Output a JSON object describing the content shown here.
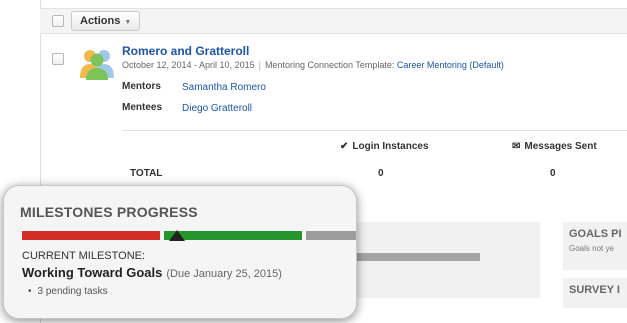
{
  "toolbar": {
    "actions_label": "Actions"
  },
  "connection": {
    "title": "Romero and Gratteroll",
    "dates": "October 12, 2014 - April 10, 2015",
    "template_prefix": "Mentoring Connection Template:",
    "template_link": "Career Mentoring (Default)",
    "mentors_label": "Mentors",
    "mentor_name": "Samantha Romero",
    "mentees_label": "Mentees",
    "mentee_name": "Diego Gratteroll"
  },
  "stats": {
    "login_header": "Login Instances",
    "messages_header": "Messages Sent",
    "total_label": "TOTAL",
    "login_total": "0",
    "messages_total": "0"
  },
  "side_panels": {
    "goals_heading": "GOALS PI",
    "goals_subtext": "Goals not ye",
    "survey_heading": "SURVEY I"
  },
  "milestones": {
    "title": "MILESTONES PROGRESS",
    "current_label": "CURRENT MILESTONE:",
    "current_name": "Working Toward Goals",
    "current_due": "(Due January 25, 2015)",
    "pending": "3 pending tasks",
    "progress_fraction": 0.45,
    "colors": {
      "completed": "#d22e26",
      "current": "#27952d",
      "upcoming": "#9c9c9c"
    }
  },
  "icons": {
    "caret": "caret-down-icon",
    "avatar": "group-avatar-icon",
    "login": "checkmark-icon",
    "messages": "envelope-icon",
    "marker": "triangle-marker-icon"
  }
}
